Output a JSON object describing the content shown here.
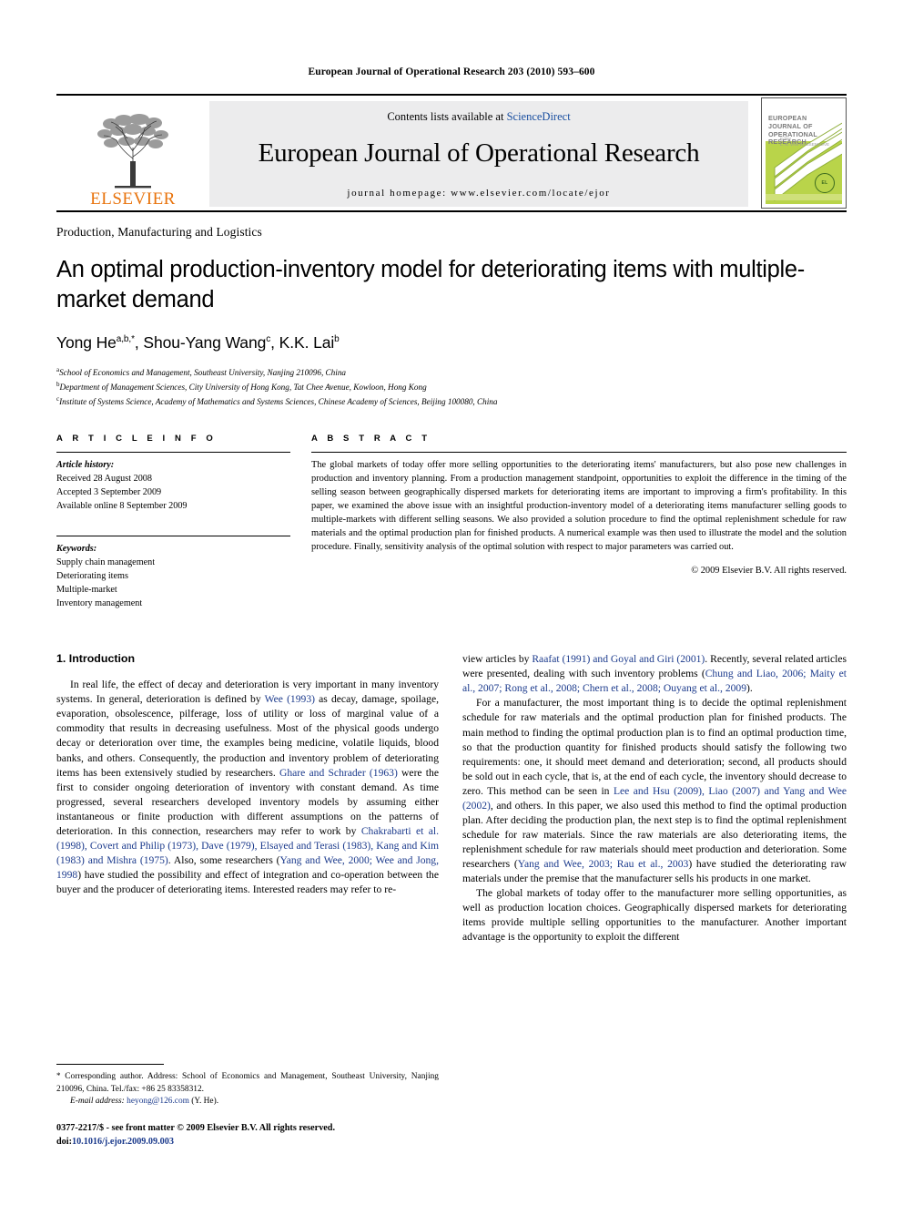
{
  "running_head": "European Journal of Operational Research 203 (2010) 593–600",
  "masthead": {
    "publisher": "ELSEVIER",
    "contents_prefix": "Contents lists available at ",
    "contents_link": "ScienceDirect",
    "journal_title": "European Journal of Operational Research",
    "homepage": "journal homepage: www.elsevier.com/locate/ejor",
    "cover": {
      "title": "EUROPEAN JOURNAL OF OPERATIONAL RESEARCH",
      "subtitle": "Editor\nL. N. VAN WASSENHOVE",
      "emblem": "ELS\nEVIER"
    }
  },
  "section_label": "Production, Manufacturing and Logistics",
  "title": "An optimal production-inventory model for deteriorating items with multiple-market demand",
  "authors": {
    "a1_name": "Yong He",
    "a1_sup": "a,b,*",
    "sep1": ", ",
    "a2_name": "Shou-Yang Wang",
    "a2_sup": "c",
    "sep2": ", ",
    "a3_name": "K.K. Lai",
    "a3_sup": "b"
  },
  "affiliations": [
    {
      "sup": "a",
      "text": "School of Economics and Management, Southeast University, Nanjing 210096, China"
    },
    {
      "sup": "b",
      "text": "Department of Management Sciences, City University of Hong Kong, Tat Chee Avenue, Kowloon, Hong Kong"
    },
    {
      "sup": "c",
      "text": "Institute of Systems Science, Academy of Mathematics and Systems Sciences, Chinese Academy of Sciences, Beijing 100080, China"
    }
  ],
  "article_info": {
    "header": "A R T I C L E    I N F O",
    "history_label": "Article history:",
    "history": [
      "Received 28 August 2008",
      "Accepted 3 September 2009",
      "Available online 8 September 2009"
    ],
    "keywords_label": "Keywords:",
    "keywords": [
      "Supply chain management",
      "Deteriorating items",
      "Multiple-market",
      "Inventory management"
    ]
  },
  "abstract": {
    "header": "A B S T R A C T",
    "text": "The global markets of today offer more selling opportunities to the deteriorating items' manufacturers, but also pose new challenges in production and inventory planning. From a production management standpoint, opportunities to exploit the difference in the timing of the selling season between geographically dispersed markets for deteriorating items are important to improving a firm's profitability. In this paper, we examined the above issue with an insightful production-inventory model of a deteriorating items manufacturer selling goods to multiple-markets with different selling seasons. We also provided a solution procedure to find the optimal replenishment schedule for raw materials and the optimal production plan for finished products. A numerical example was then used to illustrate the model and the solution procedure. Finally, sensitivity analysis of the optimal solution with respect to major parameters was carried out.",
    "copyright": "© 2009 Elsevier B.V. All rights reserved."
  },
  "body": {
    "section_number_title": "1. Introduction",
    "left_paragraphs": [
      [
        {
          "t": "In real life, the effect of decay and deterioration is very important in many inventory systems. In general, deterioration is defined by "
        },
        {
          "t": "Wee (1993)",
          "ref": true
        },
        {
          "t": " as decay, damage, spoilage, evaporation, obsolescence, pilferage, loss of utility or loss of marginal value of a commodity that results in decreasing usefulness. Most of the physical goods undergo decay or deterioration over time, the examples being medicine, volatile liquids, blood banks, and others. Consequently, the production and inventory problem of deteriorating items has been extensively studied by researchers. "
        },
        {
          "t": "Ghare and Schrader (1963)",
          "ref": true
        },
        {
          "t": " were the first to consider ongoing deterioration of inventory with constant demand. As time progressed, several researchers developed inventory models by assuming either instantaneous or finite production with different assumptions on the patterns of deterioration. In this connection, researchers may refer to work by "
        },
        {
          "t": "Chakrabarti et al. (1998), Covert and Philip (1973), Dave (1979), Elsayed and Terasi (1983), Kang and Kim (1983) and Mishra (1975)",
          "ref": true
        },
        {
          "t": ". Also, some researchers ("
        },
        {
          "t": "Yang and Wee, 2000; Wee and Jong, 1998",
          "ref": true
        },
        {
          "t": ") have studied the possibility and effect of integration and co-operation between the buyer and the producer of deteriorating items. Interested readers may refer to re-"
        }
      ]
    ],
    "right_paragraphs": [
      [
        {
          "t": "view articles by "
        },
        {
          "t": "Raafat (1991) and Goyal and Giri (2001)",
          "ref": true
        },
        {
          "t": ". Recently, several related articles were presented, dealing with such inventory problems ("
        },
        {
          "t": "Chung and Liao, 2006; Maity et al., 2007; Rong et al., 2008; Chern et al., 2008; Ouyang et al., 2009",
          "ref": true
        },
        {
          "t": ")."
        }
      ],
      [
        {
          "t": "For a manufacturer, the most important thing is to decide the optimal replenishment schedule for raw materials and the optimal production plan for finished products. The main method to finding the optimal production plan is to find an optimal production time, so that the production quantity for finished products should satisfy the following two requirements: one, it should meet demand and deterioration; second, all products should be sold out in each cycle, that is, at the end of each cycle, the inventory should decrease to zero. This method can be seen in "
        },
        {
          "t": "Lee and Hsu (2009), Liao (2007) and Yang and Wee (2002)",
          "ref": true
        },
        {
          "t": ", and others. In this paper, we also used this method to find the optimal production plan. After deciding the production plan, the next step is to find the optimal replenishment schedule for raw materials. Since the raw materials are also deteriorating items, the replenishment schedule for raw materials should meet production and deterioration. Some researchers ("
        },
        {
          "t": "Yang and Wee, 2003; Rau et al., 2003",
          "ref": true
        },
        {
          "t": ") have studied the deteriorating raw materials under the premise that the manufacturer sells his products in one market."
        }
      ],
      [
        {
          "t": "The global markets of today offer to the manufacturer more selling opportunities, as well as production location choices. Geographically dispersed markets for deteriorating items provide multiple selling opportunities to the manufacturer. Another important advantage is the opportunity to exploit the different"
        }
      ]
    ]
  },
  "footnote": {
    "star": "*",
    "text": " Corresponding author. Address: School of Economics and Management, Southeast University, Nanjing 210096, China. Tel./fax: +86 25 83358312.",
    "email_label": "E-mail address:",
    "email": "heyong@126.com",
    "email_suffix": " (Y. He)."
  },
  "imprint": {
    "line1": "0377-2217/$ - see front matter © 2009 Elsevier B.V. All rights reserved.",
    "doi_label": "doi:",
    "doi": "10.1016/j.ejor.2009.09.003"
  },
  "colors": {
    "link_blue": "#1a4fa0",
    "ref_blue": "#1b3a8c",
    "elsevier_orange": "#E8730C",
    "band_gray": "#ececed",
    "cover_green": "#b9d44a"
  }
}
